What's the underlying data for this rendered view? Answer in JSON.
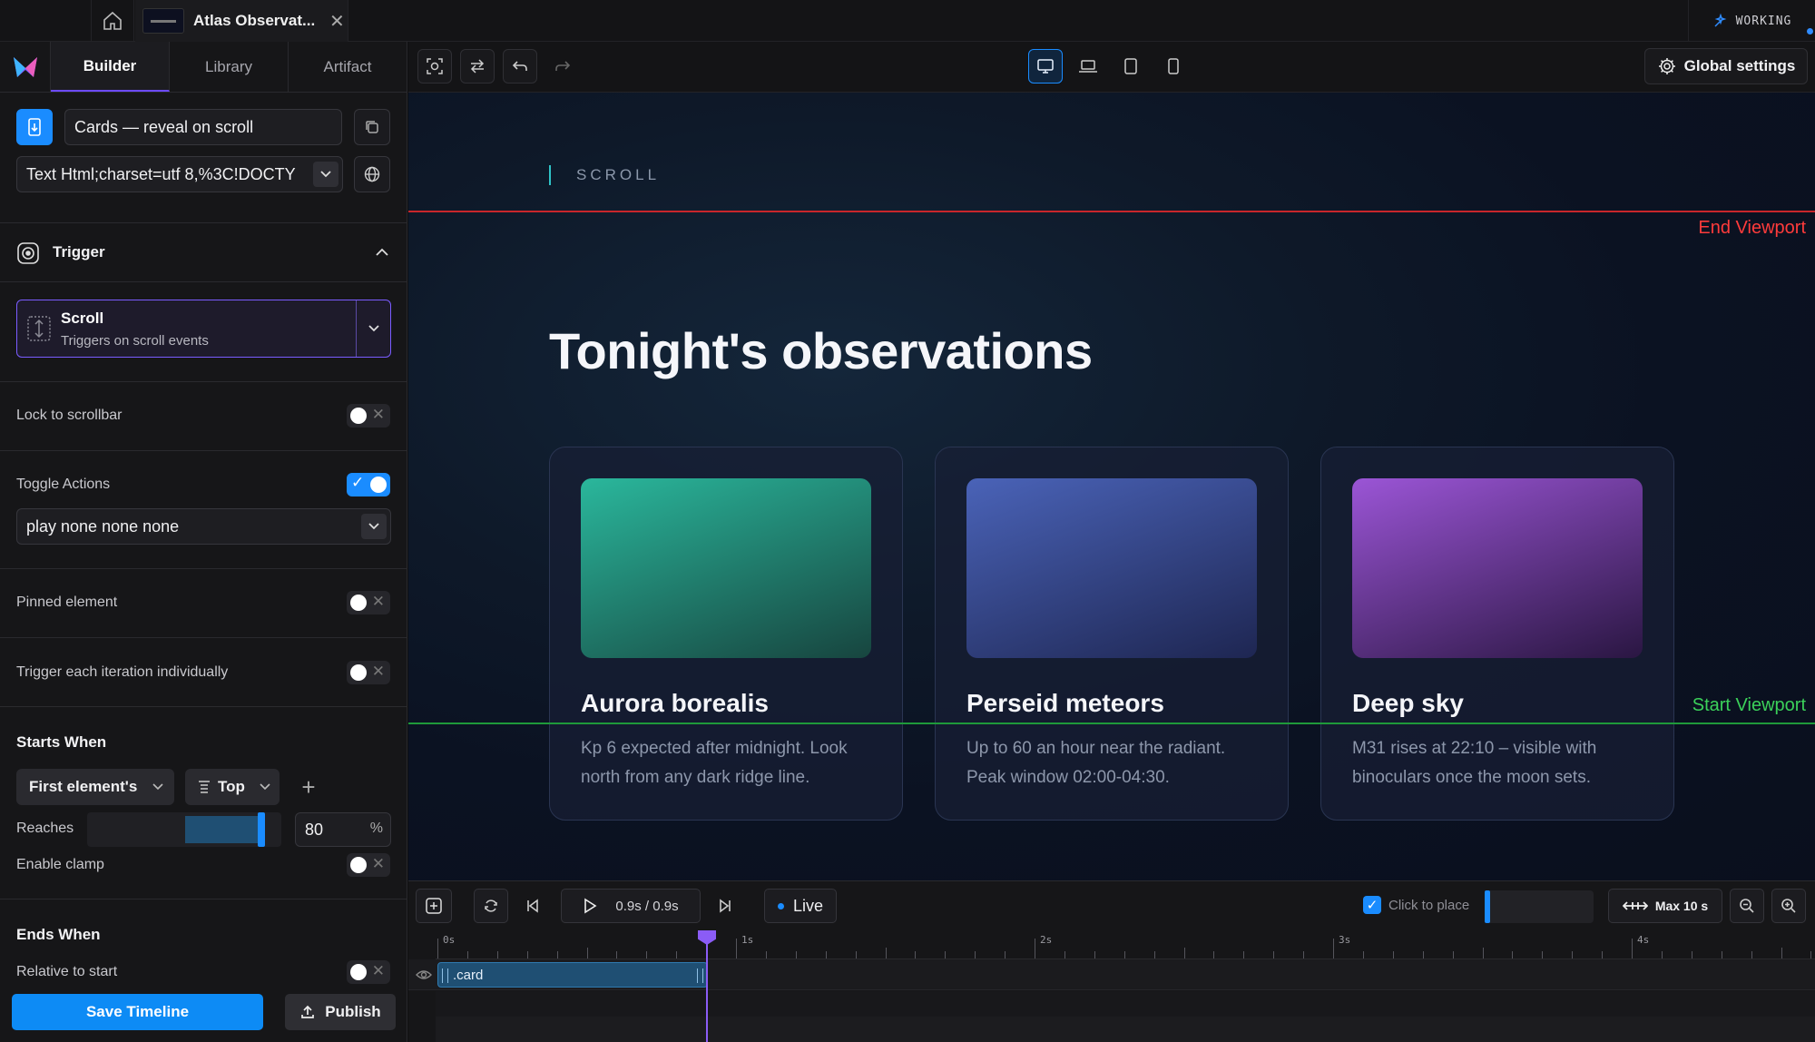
{
  "topbar": {
    "tab_title": "Atlas Observat...",
    "status": "WORKING"
  },
  "left": {
    "tabs": [
      "Builder",
      "Library",
      "Artifact"
    ],
    "animation_name": "Cards — reveal on scroll",
    "source": "Text Html;charset=utf 8,%3C!DOCTY",
    "trigger_heading": "Trigger",
    "trigger_type": "Scroll",
    "trigger_desc": "Triggers on scroll events",
    "lock_scrollbar": "Lock to scrollbar",
    "toggle_actions": "Toggle Actions",
    "toggle_actions_value": "play none none none",
    "pinned_element": "Pinned element",
    "trigger_each": "Trigger each iteration individually",
    "starts_when": "Starts When",
    "first_element": "First element's",
    "top": "Top",
    "reaches": "Reaches",
    "reaches_value": "80",
    "percent": "%",
    "enable_clamp": "Enable clamp",
    "ends_when": "Ends When",
    "relative_start": "Relative to start",
    "save_timeline": "Save Timeline",
    "publish": "Publish"
  },
  "toolbar": {
    "global_settings": "Global settings"
  },
  "canvas": {
    "scroll_label": "SCROLL",
    "end_viewport": "End Viewport",
    "start_viewport": "Start Viewport",
    "title": "Tonight's observations",
    "cards": [
      {
        "name": "Aurora borealis",
        "desc": "Kp 6 expected after midnight. Look north from any dark ridge line.",
        "colors": [
          "#2ab79c",
          "#17453f"
        ]
      },
      {
        "name": "Perseid meteors",
        "desc": "Up to 60 an hour near the radiant. Peak window 02:00-04:30.",
        "colors": [
          "#4a63b8",
          "#1e2652"
        ]
      },
      {
        "name": "Deep sky",
        "desc": "M31 rises at 22:10 – visible with binoculars once the moon sets.",
        "colors": [
          "#9b55d6",
          "#2a1642"
        ]
      }
    ]
  },
  "timeline": {
    "time": "0.9s / 0.9s",
    "live": "Live",
    "click_to_place": "Click to place",
    "max": "Max 10 s",
    "ruler_labels": [
      "0s",
      "1s",
      "2s",
      "3s",
      "4s"
    ],
    "clip_label": ".card"
  },
  "colors": {
    "accent": "#1a8cff",
    "purple": "#8b5cf6",
    "end_line": "#c8262b",
    "start_line": "#1f9a3a"
  }
}
